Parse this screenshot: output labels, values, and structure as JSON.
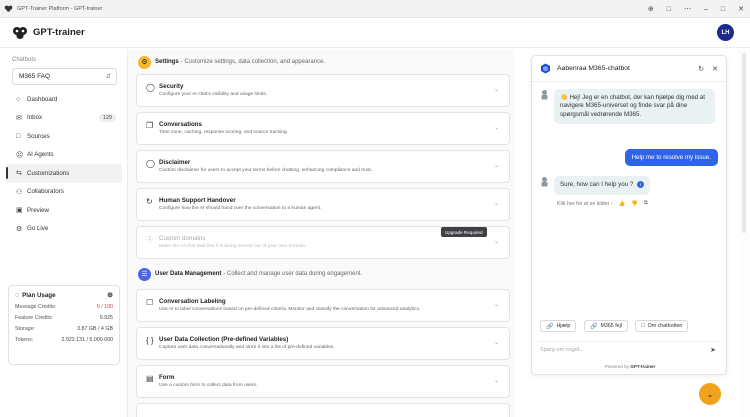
{
  "window": {
    "title": "GPT-Trainer Platform - GPT-trainer",
    "controls": [
      "⊕",
      "□",
      "⋯",
      "–",
      "□",
      "✕"
    ]
  },
  "app": {
    "brand": "GPT-trainer",
    "avatar_initials": "LH"
  },
  "sidebar": {
    "section_label": "Chatbots",
    "selected_chatbot": "M365 FAQ",
    "items": [
      {
        "label": "Dashboard",
        "icon": "○"
      },
      {
        "label": "Inbox",
        "icon": "✉",
        "badge": "129"
      },
      {
        "label": "Sources",
        "icon": "□"
      },
      {
        "label": "AI Agents",
        "icon": "☹"
      },
      {
        "label": "Customizations",
        "icon": "⇆"
      },
      {
        "label": "Collaborators",
        "icon": "⚇"
      },
      {
        "label": "Preview",
        "icon": "▣"
      },
      {
        "label": "Go Live",
        "icon": "⚙"
      }
    ],
    "plan": {
      "title": "Plan Usage",
      "rows": [
        {
          "label": "Message Credits:",
          "value": "0 / 100"
        },
        {
          "label": "Feature Credits:",
          "value": "9.925"
        },
        {
          "label": "Storage:",
          "value": "3.87 GB / 4 GB"
        },
        {
          "label": "Tokens:",
          "value": "2.922.131 / 5.000.000"
        }
      ]
    }
  },
  "main": {
    "settings_header": {
      "title": "Settings",
      "desc": "- Customize settings, data collection, and appearance."
    },
    "settings_cards": [
      {
        "title": "Security",
        "desc": "Configure your AI chat's visibility and usage limits."
      },
      {
        "title": "Conversations",
        "desc": "Time zone, caching, response scoring, and source tracking."
      },
      {
        "title": "Disclaimer",
        "desc": "Custom disclaimer for users to accept your terms before chatting, enhancing compliance and trust."
      },
      {
        "title": "Human Support Handover",
        "desc": "Configure how the AI should hand over the conversation to a human agent."
      },
      {
        "title": "Custom domains",
        "desc": "Make the AI chat look like it is being served out of your own domain."
      }
    ],
    "upgrade_label": "Upgrade Required",
    "udm_header": {
      "title": "User Data Management",
      "desc": "- Collect and manage user data during engagement."
    },
    "udm_cards": [
      {
        "title": "Conversation Labeling",
        "desc": "Use AI to label conversations based on pre-defined criteria. Monitor and classify the conversation for advanced analytics."
      },
      {
        "title": "User Data Collection (Pre-defined Variables)",
        "desc": "Capture user data conversationally and store it into a list of pre-defined variables."
      },
      {
        "title": "Form",
        "desc": "Use a custom form to collect data from users."
      }
    ]
  },
  "chat": {
    "title": "Aabenraa M365-chatbot",
    "bot_greeting": "Hej! Jeg er en chatbot, der kan hjælpe dig med at navigere M365-universet og finde svar på dine spørgsmål vedrørende M365.",
    "greeting_emoji": "👋",
    "user_message": "Help me to resolve my issue.",
    "bot_reply": "Sure, how can I help you ?",
    "sources_link": "Klik her for at se kilder",
    "quick_replies": [
      "Hjælp",
      "M365 fejl",
      "Om chatbotten"
    ],
    "input_placeholder": "Spørg om noget...",
    "powered_prefix": "Powered by",
    "powered_brand": "GPT-trainer"
  },
  "colors": {
    "accent": "#2f64e6",
    "settings_icon_bg": "#f5b82e",
    "udm_icon_bg": "#4a63e7",
    "fab": "#f0a21d",
    "avatar": "#1c2a8f"
  }
}
